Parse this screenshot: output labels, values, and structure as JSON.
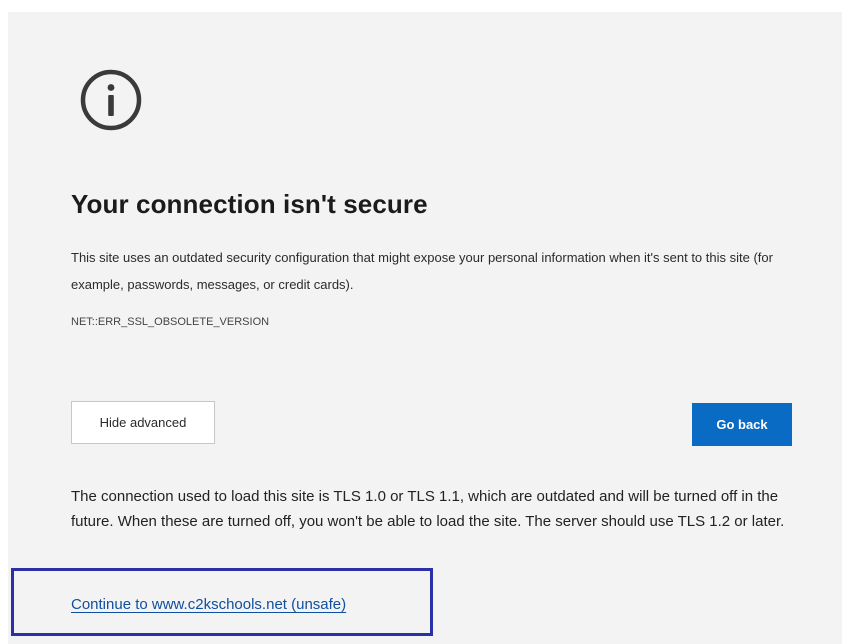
{
  "icon": "info-circle-icon",
  "title": "Your connection isn't secure",
  "description": "This site uses an outdated security configuration that might expose your personal information when it's sent to this site (for example, passwords, messages, or credit cards).",
  "error_code": "NET::ERR_SSL_OBSOLETE_VERSION",
  "buttons": {
    "hide_advanced": "Hide advanced",
    "go_back": "Go back"
  },
  "advanced_text": "The connection used to load this site is TLS 1.0 or TLS 1.1, which are outdated and will be turned off in the future. When these are turned off, you won't be able to load the site. The server should use TLS 1.2 or later.",
  "continue_link": "Continue to www.c2kschools.net (unsafe)",
  "colors": {
    "background": "#f3f3f3",
    "primary_button": "#0a6bc4",
    "link": "#0f4f9e",
    "highlight_border": "#2b2fa8"
  }
}
